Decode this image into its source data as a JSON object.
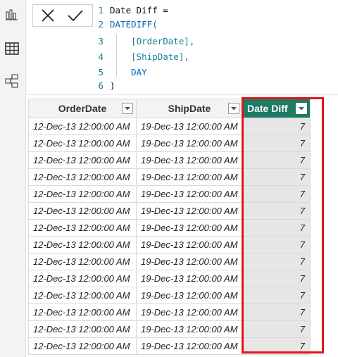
{
  "sidebar": {
    "items": [
      {
        "name": "report-view",
        "icon": "bar-chart-icon"
      },
      {
        "name": "data-view",
        "icon": "table-grid-icon"
      },
      {
        "name": "model-view",
        "icon": "model-diagram-icon"
      }
    ]
  },
  "formula_bar": {
    "cancel_icon": "close-icon",
    "commit_icon": "checkmark-icon",
    "lines": [
      {
        "n": "1",
        "text": "Date Diff ="
      },
      {
        "n": "2",
        "text": "DATEDIFF("
      },
      {
        "n": "3",
        "text": "    [OrderDate],"
      },
      {
        "n": "4",
        "text": "    [ShipDate],"
      },
      {
        "n": "5",
        "text": "    DAY"
      },
      {
        "n": "6",
        "text": ")"
      }
    ]
  },
  "table": {
    "columns": [
      {
        "label": "OrderDate"
      },
      {
        "label": "ShipDate"
      },
      {
        "label": "Date Diff"
      }
    ],
    "rows": [
      [
        "12-Dec-13 12:00:00 AM",
        "19-Dec-13 12:00:00 AM",
        "7"
      ],
      [
        "12-Dec-13 12:00:00 AM",
        "19-Dec-13 12:00:00 AM",
        "7"
      ],
      [
        "12-Dec-13 12:00:00 AM",
        "19-Dec-13 12:00:00 AM",
        "7"
      ],
      [
        "12-Dec-13 12:00:00 AM",
        "19-Dec-13 12:00:00 AM",
        "7"
      ],
      [
        "12-Dec-13 12:00:00 AM",
        "19-Dec-13 12:00:00 AM",
        "7"
      ],
      [
        "12-Dec-13 12:00:00 AM",
        "19-Dec-13 12:00:00 AM",
        "7"
      ],
      [
        "12-Dec-13 12:00:00 AM",
        "19-Dec-13 12:00:00 AM",
        "7"
      ],
      [
        "12-Dec-13 12:00:00 AM",
        "19-Dec-13 12:00:00 AM",
        "7"
      ],
      [
        "12-Dec-13 12:00:00 AM",
        "19-Dec-13 12:00:00 AM",
        "7"
      ],
      [
        "12-Dec-13 12:00:00 AM",
        "19-Dec-13 12:00:00 AM",
        "7"
      ],
      [
        "12-Dec-13 12:00:00 AM",
        "19-Dec-13 12:00:00 AM",
        "7"
      ],
      [
        "12-Dec-13 12:00:00 AM",
        "19-Dec-13 12:00:00 AM",
        "7"
      ],
      [
        "12-Dec-13 12:00:00 AM",
        "19-Dec-13 12:00:00 AM",
        "7"
      ],
      [
        "12-Dec-13 12:00:00 AM",
        "19-Dec-13 12:00:00 AM",
        "7"
      ]
    ]
  },
  "colors": {
    "selected_header": "#1f7a63",
    "highlight_border": "#e0161b",
    "keyword": "#0067b8"
  }
}
